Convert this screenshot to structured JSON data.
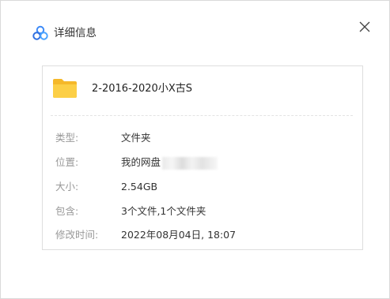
{
  "dialog": {
    "title": "详细信息",
    "close_symbol": "✕",
    "accent_color": "#3d8af7"
  },
  "file": {
    "name": "2-2016-2020小X古S",
    "icon": "folder-icon",
    "icon_color": "#f9c436"
  },
  "details": [
    {
      "label": "类型:",
      "value": "文件夹"
    },
    {
      "label": "位置:",
      "value": "我的网盘"
    },
    {
      "label": "大小:",
      "value": "2.54GB"
    },
    {
      "label": "包含:",
      "value": "3个文件,1个文件夹"
    },
    {
      "label": "修改时间:",
      "value": "2022年08月04日, 18:07"
    }
  ]
}
